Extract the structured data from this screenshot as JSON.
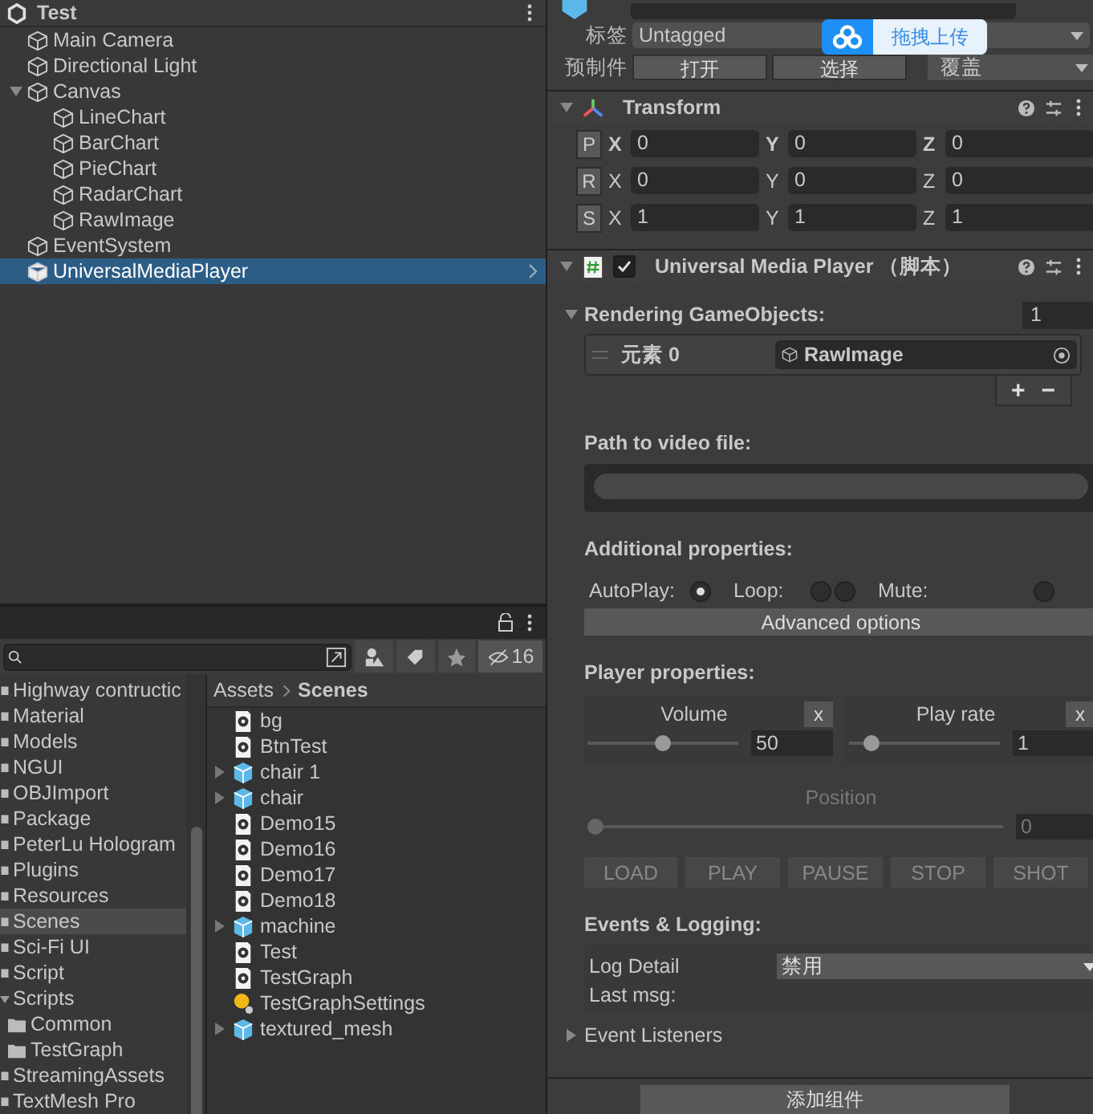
{
  "hierarchy": {
    "scene": "Test",
    "items": [
      {
        "name": "Main Camera",
        "selected": false
      },
      {
        "name": "Directional Light",
        "selected": false
      },
      {
        "name": "Canvas",
        "selected": false,
        "expanded": true,
        "children": [
          {
            "name": "LineChart",
            "selected": false
          },
          {
            "name": "BarChart",
            "selected": false
          },
          {
            "name": "PieChart",
            "selected": false
          },
          {
            "name": "RadarChart",
            "selected": false
          },
          {
            "name": "RawImage",
            "selected": false
          }
        ]
      },
      {
        "name": "EventSystem",
        "selected": false
      },
      {
        "name": "UniversalMediaPlayer",
        "selected": true
      }
    ]
  },
  "project": {
    "hidden_count": "16",
    "folders": [
      {
        "name": "Highway contructic",
        "selected": false
      },
      {
        "name": "Material",
        "selected": false
      },
      {
        "name": "Models",
        "selected": false
      },
      {
        "name": "NGUI",
        "selected": false
      },
      {
        "name": "OBJImport",
        "selected": false
      },
      {
        "name": "Package",
        "selected": false
      },
      {
        "name": "PeterLu Hologram",
        "selected": false
      },
      {
        "name": "Plugins",
        "selected": false
      },
      {
        "name": "Resources",
        "selected": false
      },
      {
        "name": "Scenes",
        "selected": true
      },
      {
        "name": "Sci-Fi UI",
        "selected": false
      },
      {
        "name": "Script",
        "selected": false
      },
      {
        "name": "Scripts",
        "selected": false,
        "expanded": true,
        "children": [
          {
            "name": "Common",
            "selected": false
          },
          {
            "name": "TestGraph",
            "selected": false
          }
        ]
      },
      {
        "name": "StreamingAssets",
        "selected": false
      },
      {
        "name": "TextMesh Pro",
        "selected": false
      }
    ],
    "breadcrumb": [
      "Assets",
      "Scenes"
    ],
    "assets": [
      {
        "name": "bg",
        "kind": "scene"
      },
      {
        "name": "BtnTest",
        "kind": "scene"
      },
      {
        "name": "chair 1",
        "kind": "model"
      },
      {
        "name": "chair",
        "kind": "model"
      },
      {
        "name": "Demo15",
        "kind": "scene"
      },
      {
        "name": "Demo16",
        "kind": "scene"
      },
      {
        "name": "Demo17",
        "kind": "scene"
      },
      {
        "name": "Demo18",
        "kind": "scene"
      },
      {
        "name": "machine",
        "kind": "model"
      },
      {
        "name": "Test",
        "kind": "scene"
      },
      {
        "name": "TestGraph",
        "kind": "scene"
      },
      {
        "name": "TestGraphSettings",
        "kind": "settings"
      },
      {
        "name": "textured_mesh",
        "kind": "model"
      }
    ]
  },
  "inspector": {
    "tag": {
      "label": "标签",
      "value": "Untagged"
    },
    "prefab": {
      "label": "预制件",
      "buttons": [
        "打开",
        "选择"
      ],
      "override": "覆盖"
    },
    "upload_badge": "拖拽上传",
    "transform": {
      "title": "Transform",
      "expanded": true,
      "rows": [
        {
          "key": "P",
          "values": [
            {
              "axis": "X",
              "value": "0"
            },
            {
              "axis": "Y",
              "value": "0"
            },
            {
              "axis": "Z",
              "value": "0"
            }
          ]
        },
        {
          "key": "R",
          "values": [
            {
              "axis": "X",
              "value": "0"
            },
            {
              "axis": "Y",
              "value": "0"
            },
            {
              "axis": "Z",
              "value": "0"
            }
          ]
        },
        {
          "key": "S",
          "values": [
            {
              "axis": "X",
              "value": "1"
            },
            {
              "axis": "Y",
              "value": "1"
            },
            {
              "axis": "Z",
              "value": "1"
            }
          ]
        }
      ]
    },
    "component": {
      "title": "Universal Media Player （脚本）",
      "enabled": true,
      "expanded": true,
      "rendering": {
        "label": "Rendering GameObjects:",
        "count": "1",
        "expanded": true,
        "elements": [
          {
            "label": "元素 0",
            "value": "RawImage"
          }
        ],
        "add": "+",
        "remove": "−"
      },
      "path": {
        "label": "Path to video file:"
      },
      "additional": {
        "label": "Additional properties:",
        "options": [
          {
            "label": "AutoPlay:",
            "toggles": [
              true
            ]
          },
          {
            "label": "Loop:",
            "toggles": [
              false,
              false
            ]
          },
          {
            "label": "Mute:",
            "toggles": [
              false
            ]
          }
        ],
        "advanced": "Advanced options"
      },
      "player": {
        "label": "Player properties:",
        "sliders": [
          {
            "label": "Volume",
            "level": 0.5,
            "value": "50",
            "reset": "x"
          },
          {
            "label": "Play rate",
            "level": 0.15,
            "value": "1",
            "reset": "x"
          }
        ],
        "position": {
          "label": "Position",
          "level": 0,
          "value": "0"
        },
        "buttons": [
          "LOAD",
          "PLAY",
          "PAUSE",
          "STOP",
          "SHOT"
        ]
      },
      "events": {
        "label": "Events & Logging:",
        "log_detail": {
          "label": "Log Detail",
          "value": "禁用"
        },
        "last_msg": "Last msg:",
        "listeners": {
          "label": "Event Listeners",
          "expanded": false
        }
      }
    },
    "add_component": "添加组件"
  }
}
